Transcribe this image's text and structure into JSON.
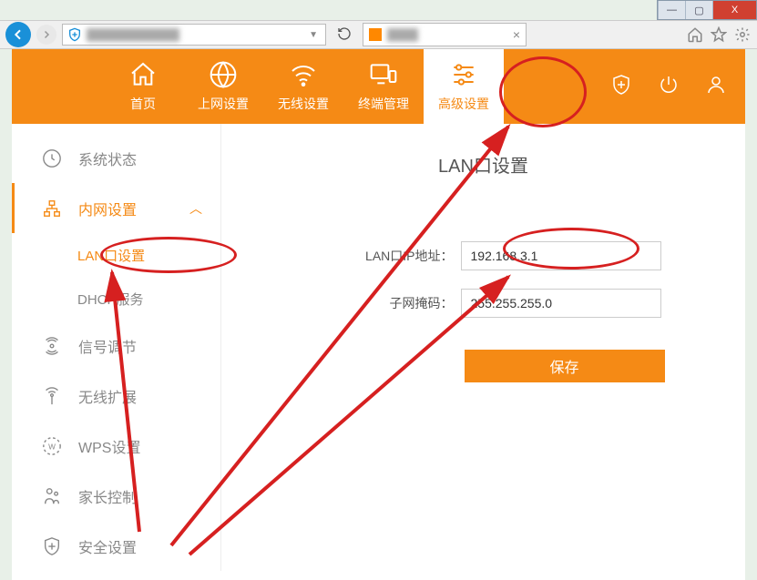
{
  "window": {
    "min": "—",
    "max": "▢",
    "close": "X"
  },
  "topnav": [
    {
      "label": "首页"
    },
    {
      "label": "上网设置"
    },
    {
      "label": "无线设置"
    },
    {
      "label": "终端管理"
    },
    {
      "label": "高级设置"
    }
  ],
  "sidebar": {
    "items": [
      {
        "label": "系统状态"
      },
      {
        "label": "内网设置"
      },
      {
        "label": "信号调节"
      },
      {
        "label": "无线扩展"
      },
      {
        "label": "WPS设置"
      },
      {
        "label": "家长控制"
      },
      {
        "label": "安全设置"
      }
    ],
    "subitems": [
      {
        "label": "LAN口设置"
      },
      {
        "label": "DHCP服务"
      }
    ]
  },
  "content": {
    "title": "LAN口设置",
    "ip_label": "LAN口IP地址：",
    "ip_value": "192.168.3.1",
    "mask_label": "子网掩码：",
    "mask_value": "255.255.255.0",
    "save": "保存"
  }
}
